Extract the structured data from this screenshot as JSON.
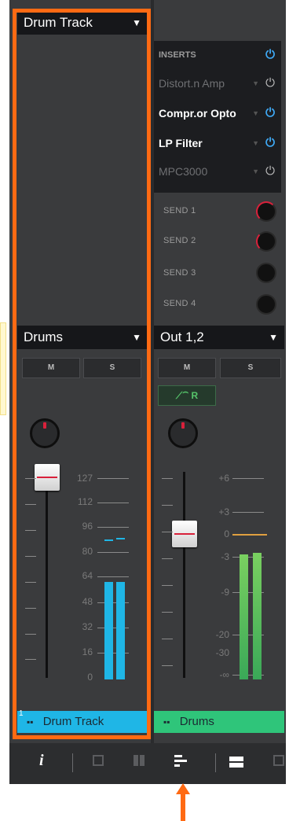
{
  "left_strip": {
    "title": "Drum Track",
    "output": "Drums",
    "mute_label": "M",
    "solo_label": "S",
    "scale": [
      "127",
      "112",
      "96",
      "80",
      "64",
      "48",
      "32",
      "16",
      "0"
    ],
    "track_label": "Drum Track",
    "track_number": "1",
    "track_color": "#1fb6e6"
  },
  "right_strip": {
    "inserts_header": "INSERTS",
    "inserts": [
      {
        "name": "Distort.n Amp",
        "active": false
      },
      {
        "name": "Compr.or Opto",
        "active": true
      },
      {
        "name": "LP Filter",
        "active": true
      },
      {
        "name": "MPC3000",
        "active": false
      }
    ],
    "sends": [
      "SEND 1",
      "SEND 2",
      "SEND 3",
      "SEND 4"
    ],
    "output": "Out 1,2",
    "mute_label": "M",
    "solo_label": "S",
    "automation_label": "R",
    "scale": [
      "+6",
      "+3",
      "0",
      "-3",
      "-9",
      "-20",
      "-30",
      "-∞"
    ],
    "track_label": "Drums",
    "track_color": "#2fc57a"
  },
  "toolbar": {
    "info_label": "i"
  },
  "colors": {
    "highlight": "#ff6a13",
    "accent_blue": "#1fb6e6",
    "meter_green": "#56c46a"
  }
}
